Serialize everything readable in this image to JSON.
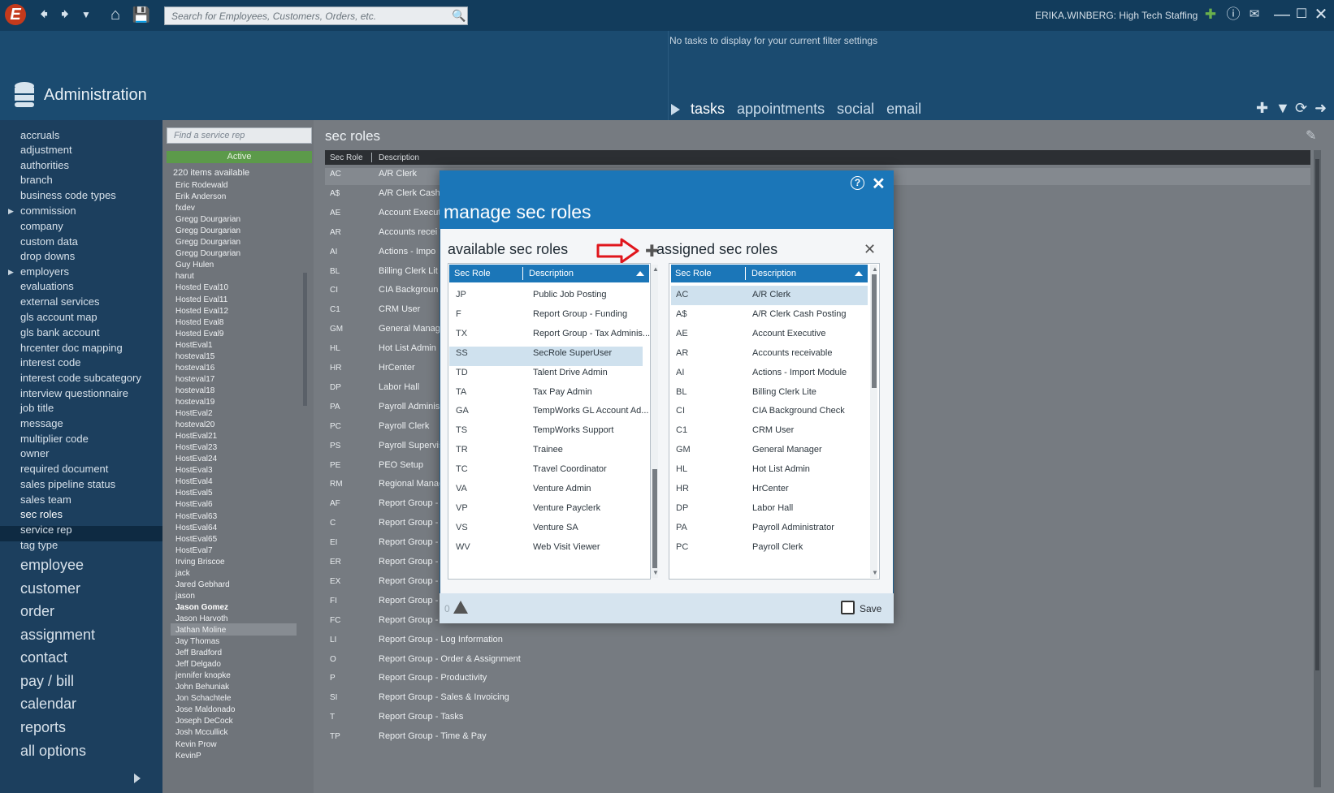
{
  "topbar": {
    "logo": "E",
    "search_placeholder": "Search for Employees, Customers, Orders, etc.",
    "user": "ERIKA.WINBERG: High Tech Staffing"
  },
  "header": {
    "no_tasks": "No tasks to display for your current filter settings",
    "section_title": "Administration",
    "tabs": [
      "tasks",
      "appointments",
      "social",
      "email"
    ]
  },
  "nav": {
    "items": [
      "accruals",
      "adjustment",
      "authorities",
      "branch",
      "business code types",
      "commission",
      "company",
      "custom data",
      "drop downs",
      "employers",
      "evaluations",
      "external services",
      "gls account map",
      "gls bank account",
      "hrcenter doc mapping",
      "interest code",
      "interest code subcategory",
      "interview questionnaire",
      "job title",
      "message",
      "multiplier code",
      "owner",
      "required document",
      "sales pipeline status",
      "sales team",
      "sec roles",
      "service rep",
      "tag type"
    ],
    "big_items": [
      "employee",
      "customer",
      "order",
      "assignment",
      "contact",
      "pay / bill",
      "calendar",
      "reports",
      "all options"
    ]
  },
  "reps": {
    "find_placeholder": "Find a service rep",
    "filter": "Active",
    "count": "220 items available",
    "names": [
      "Eric Rodewald",
      "Erik Anderson",
      "fxdev",
      "Gregg Dourgarian",
      "Gregg Dourgarian",
      "Gregg Dourgarian",
      "Gregg Dourgarian",
      "Guy Hulen",
      "harut",
      "Hosted Eval10",
      "Hosted Eval11",
      "Hosted Eval12",
      "Hosted Eval8",
      "Hosted Eval9",
      "HostEval1",
      "hosteval15",
      "hosteval16",
      "hosteval17",
      "hosteval18",
      "hosteval19",
      "HostEval2",
      "hosteval20",
      "HostEval21",
      "HostEval23",
      "HostEval24",
      "HostEval3",
      "HostEval4",
      "HostEval5",
      "HostEval6",
      "HostEval63",
      "HostEval64",
      "HostEval65",
      "HostEval7",
      "Irving Briscoe",
      "jack",
      "Jared Gebhard",
      "jason",
      "Jason Gomez",
      "Jason Harvoth",
      "Jathan Moline",
      "Jay Thomas",
      "Jeff Bradford",
      "Jeff Delgado",
      "jennifer knopke",
      "John Behuniak",
      "Jon Schachtele",
      "Jose Maldonado",
      "Joseph DeCock",
      "Josh Mccullick",
      "Kevin Prow",
      "KevinP"
    ]
  },
  "main": {
    "title": "sec roles",
    "col_role": "Sec Role",
    "col_desc": "Description",
    "rows": [
      {
        "code": "AC",
        "desc": "A/R Clerk"
      },
      {
        "code": "A$",
        "desc": "A/R Clerk Cash"
      },
      {
        "code": "AE",
        "desc": "Account Execut"
      },
      {
        "code": "AR",
        "desc": "Accounts recei"
      },
      {
        "code": "AI",
        "desc": "Actions - Impo"
      },
      {
        "code": "BL",
        "desc": "Billing Clerk Lit"
      },
      {
        "code": "CI",
        "desc": "CIA Backgroun"
      },
      {
        "code": "C1",
        "desc": "CRM User"
      },
      {
        "code": "GM",
        "desc": "General Manag"
      },
      {
        "code": "HL",
        "desc": "Hot List Admin"
      },
      {
        "code": "HR",
        "desc": "HrCenter"
      },
      {
        "code": "DP",
        "desc": "Labor Hall"
      },
      {
        "code": "PA",
        "desc": "Payroll Adminis"
      },
      {
        "code": "PC",
        "desc": "Payroll Clerk"
      },
      {
        "code": "PS",
        "desc": "Payroll Supervis"
      },
      {
        "code": "PE",
        "desc": "PEO Setup"
      },
      {
        "code": "RM",
        "desc": "Regional Manag"
      },
      {
        "code": "AF",
        "desc": "Report Group -"
      },
      {
        "code": "C",
        "desc": "Report Group -"
      },
      {
        "code": "EI",
        "desc": "Report Group -"
      },
      {
        "code": "ER",
        "desc": "Report Group -"
      },
      {
        "code": "EX",
        "desc": "Report Group -"
      },
      {
        "code": "FI",
        "desc": "Report Group -"
      },
      {
        "code": "FC",
        "desc": "Report Group - Forecast"
      },
      {
        "code": "LI",
        "desc": "Report Group - Log Information"
      },
      {
        "code": "O",
        "desc": "Report Group - Order & Assignment"
      },
      {
        "code": "P",
        "desc": "Report Group - Productivity"
      },
      {
        "code": "SI",
        "desc": "Report Group - Sales & Invoicing"
      },
      {
        "code": "T",
        "desc": "Report Group - Tasks"
      },
      {
        "code": "TP",
        "desc": "Report Group - Time & Pay"
      }
    ]
  },
  "modal": {
    "title": "manage sec roles",
    "available_title": "available sec roles",
    "assigned_title": "assigned sec roles",
    "col_role": "Sec Role",
    "col_desc": "Description",
    "available": [
      {
        "code": "JP",
        "desc": "Public Job Posting"
      },
      {
        "code": "F",
        "desc": "Report Group - Funding"
      },
      {
        "code": "TX",
        "desc": "Report Group - Tax Adminis..."
      },
      {
        "code": "SS",
        "desc": "SecRole SuperUser"
      },
      {
        "code": "TD",
        "desc": "Talent Drive Admin"
      },
      {
        "code": "TA",
        "desc": "Tax Pay Admin"
      },
      {
        "code": "GA",
        "desc": "TempWorks GL Account Ad..."
      },
      {
        "code": "TS",
        "desc": "TempWorks Support"
      },
      {
        "code": "TR",
        "desc": "Trainee"
      },
      {
        "code": "TC",
        "desc": "Travel Coordinator"
      },
      {
        "code": "VA",
        "desc": "Venture Admin"
      },
      {
        "code": "VP",
        "desc": "Venture Payclerk"
      },
      {
        "code": "VS",
        "desc": "Venture SA"
      },
      {
        "code": "WV",
        "desc": "Web Visit Viewer"
      }
    ],
    "assigned": [
      {
        "code": "AC",
        "desc": "A/R Clerk"
      },
      {
        "code": "A$",
        "desc": "A/R Clerk Cash Posting"
      },
      {
        "code": "AE",
        "desc": "Account Executive"
      },
      {
        "code": "AR",
        "desc": "Accounts receivable"
      },
      {
        "code": "AI",
        "desc": "Actions - Import Module"
      },
      {
        "code": "BL",
        "desc": "Billing Clerk Lite"
      },
      {
        "code": "CI",
        "desc": "CIA Background Check"
      },
      {
        "code": "C1",
        "desc": "CRM User"
      },
      {
        "code": "GM",
        "desc": "General Manager"
      },
      {
        "code": "HL",
        "desc": "Hot List Admin"
      },
      {
        "code": "HR",
        "desc": "HrCenter"
      },
      {
        "code": "DP",
        "desc": "Labor Hall"
      },
      {
        "code": "PA",
        "desc": "Payroll Administrator"
      },
      {
        "code": "PC",
        "desc": "Payroll Clerk"
      }
    ],
    "warning_count": "0",
    "save_label": "Save"
  }
}
